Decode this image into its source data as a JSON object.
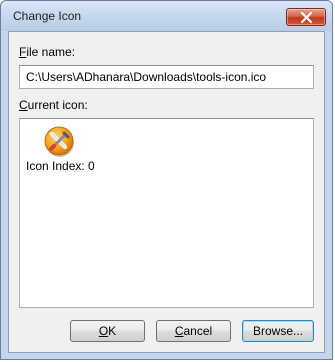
{
  "window": {
    "title": "Change Icon",
    "close_icon": "close-x-icon"
  },
  "file_name": {
    "label_underlined": "F",
    "label_rest": "ile name:",
    "value": "C:\\Users\\ADhanara\\Downloads\\tools-icon.ico"
  },
  "current_icon": {
    "label_underlined": "C",
    "label_rest": "urrent icon:",
    "items": [
      {
        "icon": "tools-icon",
        "label": "Icon Index: 0"
      }
    ]
  },
  "buttons": {
    "ok_underlined": "O",
    "ok_rest": "K",
    "cancel_underlined": "C",
    "cancel_rest": "ancel",
    "browse": "Browse..."
  },
  "colors": {
    "titlebar": "#c6d8ee",
    "close_button": "#c0391f",
    "dialog_bg": "#f0f0f0",
    "icon_orange": "#f5a623"
  }
}
